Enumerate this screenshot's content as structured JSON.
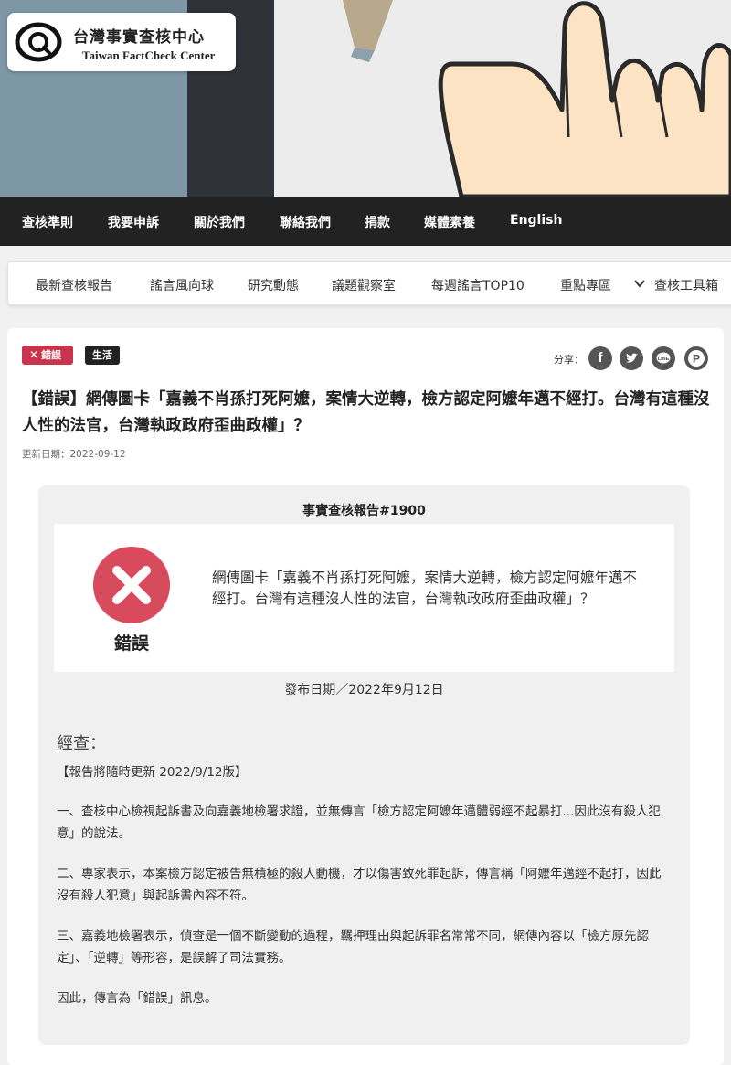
{
  "logo": {
    "name_zh": "台灣事實查核中心",
    "name_en": "Taiwan FactCheck Center",
    "icon": "magnifier-eye-icon"
  },
  "top_nav": {
    "items": [
      "查核準則",
      "我要申訴",
      "關於我們",
      "聯絡我們",
      "捐款",
      "媒體素養",
      "English"
    ]
  },
  "sub_nav": {
    "items": [
      "最新查核報告",
      "謠言風向球",
      "研究動態",
      "議題觀察室",
      "每週謠言TOP10",
      "重點專區",
      "查核工具箱"
    ]
  },
  "article": {
    "badge_false": "錯誤",
    "badge_category": "生活",
    "share_label": "分享：",
    "share_buttons": [
      "facebook-icon",
      "twitter-icon",
      "line-icon",
      "plurk-icon"
    ],
    "title": "【錯誤】網傳圖卡「嘉義不肖孫打死阿嬤，案情大逆轉，檢方認定阿嬤年邁不經打。台灣有這種沒人性的法官，台灣執政政府歪曲政權」？",
    "updated": "更新日期：2022-09-12"
  },
  "report": {
    "heading": "事實查核報告#1900",
    "verdict_label": "錯誤",
    "claim": "網傳圖卡「嘉義不肖孫打死阿嬤，案情大逆轉，檢方認定阿嬤年邁不經打。台灣有這種沒人性的法官，台灣執政政府歪曲政權」？",
    "published": "發布日期／2022年9月12日",
    "check_heading": "經查：",
    "paragraphs": [
      "【報告將隨時更新 2022/9/12版】",
      "一、查核中心檢視起訴書及向嘉義地檢署求證，並無傳言「檢方認定阿嬤年邁體弱經不起暴打...因此沒有殺人犯意」的說法。",
      "二、專家表示，本案檢方認定被告無積極的殺人動機，才以傷害致死罪起訴，傳言稱「阿嬤年邁經不起打，因此沒有殺人犯意」與起訴書內容不符。",
      "三、嘉義地檢署表示，偵查是一個不斷變動的過程，羈押理由與起訴罪名常常不同，網傳內容以「檢方原先認定」、「逆轉」等形容，是誤解了司法實務。",
      "因此，傳言為「錯誤」訊息。"
    ]
  },
  "colors": {
    "false_red": "#c8344c",
    "nav_bg": "#222222",
    "report_bg": "#f0f0f0"
  }
}
